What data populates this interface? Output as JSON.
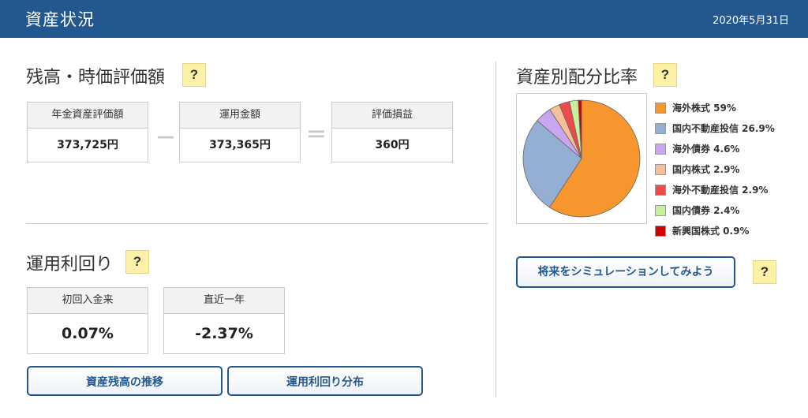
{
  "header": {
    "title": "資産状況",
    "date": "2020年5月31日"
  },
  "valuation": {
    "title": "残高・時価評価額",
    "help": "?",
    "pension_label": "年金資産評価額",
    "pension_value": "373,725円",
    "minus": "－",
    "invested_label": "運用金額",
    "invested_value": "373,365円",
    "equals": "＝",
    "gain_label": "評価損益",
    "gain_value": "360円"
  },
  "yield": {
    "title": "運用利回り",
    "help": "?",
    "since_start_label": "初回入金来",
    "since_start_value": "0.07%",
    "last_year_label": "直近一年",
    "last_year_value": "-2.37%"
  },
  "buttons": {
    "balance_history": "資産残高の推移",
    "yield_distribution": "運用利回り分布",
    "simulation": "将来をシミュレーションしてみよう",
    "simulation_help": "?"
  },
  "allocation": {
    "title": "資産別配分比率",
    "help": "?"
  },
  "chart_data": {
    "type": "pie",
    "slices": [
      {
        "name": "海外株式",
        "value": 59,
        "label": "海外株式 59%",
        "color": "#f7962e"
      },
      {
        "name": "国内不動産投信",
        "value": 26.9,
        "label": "国内不動産投信 26.9%",
        "color": "#94aed4"
      },
      {
        "name": "海外債券",
        "value": 4.6,
        "label": "海外債券 4.6%",
        "color": "#c8a7f0"
      },
      {
        "name": "国内株式",
        "value": 2.9,
        "label": "国内株式 2.9%",
        "color": "#f5bf99"
      },
      {
        "name": "海外不動産投信",
        "value": 2.9,
        "label": "海外不動産投信 2.9%",
        "color": "#ee4a4a"
      },
      {
        "name": "国内債券",
        "value": 2.4,
        "label": "国内債券 2.4%",
        "color": "#c9ee9f"
      },
      {
        "name": "新興国株式",
        "value": 0.9,
        "label": "新興国株式 0.9%",
        "color": "#d00000"
      }
    ],
    "legend_position": "right"
  }
}
